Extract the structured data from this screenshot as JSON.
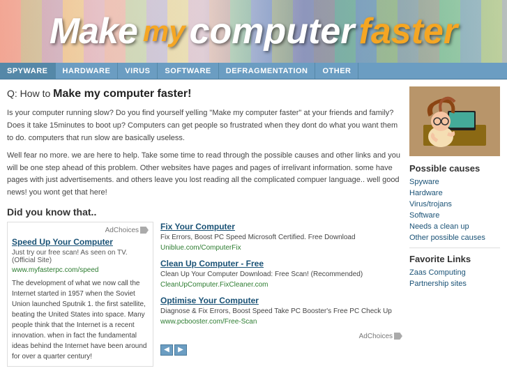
{
  "header": {
    "title_make": "Make",
    "title_my": "my",
    "title_computer": "computer",
    "title_faster": "faster"
  },
  "nav": {
    "items": [
      {
        "label": "SPYWARE",
        "active": true
      },
      {
        "label": "HARDWARE",
        "active": false
      },
      {
        "label": "VIRUS",
        "active": false
      },
      {
        "label": "SOFTWARE",
        "active": false
      },
      {
        "label": "DEFRAGMENTATION",
        "active": false
      },
      {
        "label": "OTHER",
        "active": false
      }
    ]
  },
  "main": {
    "q_prefix": "Q: How to ",
    "q_strong": "Make my computer faster!",
    "intro_p1": "Is your computer running slow? Do you find yourself yelling \"Make my computer faster\" at your friends and family? Does it take 15minutes to boot up? Computers can get people so frustrated when they dont do what you want them to do. computers that run slow are basically useless.",
    "intro_p2": "Well fear no more. we are here to help. Take some time to read through the possible causes and other links and you will be one step ahead of this problem. Other websites have pages and pages of irrelivant information. some have pages with just advertisements. and others leave you lost reading all the complicated compuer language.. well good news! you wont get that here!",
    "did_you_know": "Did you know that..",
    "ad_box": {
      "title": "Speed Up Your Computer",
      "subtitle": "Just try our free scan! As seen on TV. (Official Site)",
      "url": "www.myfasterpc.com/speed",
      "ad_choices_label": "AdChoices",
      "body": "The development of what we now call the Internet started in 1957 when the Soviet Union launched Sputnik 1. the first satellite, beating the United States into space.\n\nMany people think that the Internet is a recent innovation. when in fact the fundamental ideas behind the Internet have been around for over a quarter century!"
    },
    "links": [
      {
        "title": "Fix Your Computer",
        "desc": "Fix Errors, Boost PC Speed Microsoft Certified. Free Download",
        "url": "Uniblue.com/ComputerFix"
      },
      {
        "title": "Clean Up Computer - Free",
        "desc": "Clean Up Your Computer Download: Free Scan! (Recommended)",
        "url": "CleanUpComputer.FixCleaner.com"
      },
      {
        "title": "Optimise Your Computer",
        "desc": "Diagnose & Fix Errors, Boost Speed Take PC Booster's Free PC Check Up",
        "url": "www.pcbooster.com/Free-Scan"
      }
    ],
    "ad_choices_bottom": "AdChoices"
  },
  "sidebar": {
    "possible_causes_title": "Possible causes",
    "causes": [
      "Spyware",
      "Hardware",
      "Virus/trojans",
      "Software",
      "Needs a clean up",
      "Other possible causes"
    ],
    "favorite_links_title": "Favorite Links",
    "links": [
      "Zaas Computing",
      "Partnership sites"
    ]
  }
}
